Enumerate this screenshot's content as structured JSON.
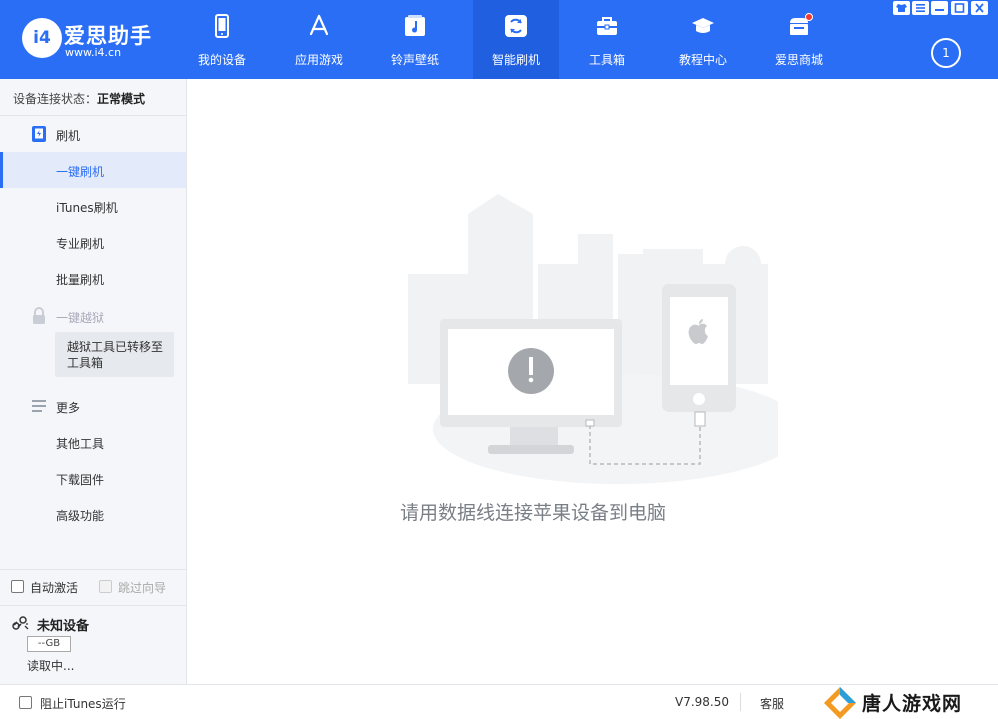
{
  "app": {
    "name": "爱思助手",
    "url": "www.i4.cn",
    "logo_text": "i4"
  },
  "nav": {
    "items": [
      {
        "label": "我的设备",
        "icon": "phone-icon"
      },
      {
        "label": "应用游戏",
        "icon": "app-store-icon"
      },
      {
        "label": "铃声壁纸",
        "icon": "music-icon"
      },
      {
        "label": "智能刷机",
        "icon": "refresh-icon",
        "active": true
      },
      {
        "label": "工具箱",
        "icon": "toolbox-icon"
      },
      {
        "label": "教程中心",
        "icon": "graduation-cap-icon"
      },
      {
        "label": "爱思商城",
        "icon": "store-icon",
        "badge": true
      }
    ],
    "downloads_count": "1"
  },
  "sidebar": {
    "connection_label": "设备连接状态：",
    "connection_value": "正常模式",
    "flash_section": "刷机",
    "flash_items": [
      "一键刷机",
      "iTunes刷机",
      "专业刷机",
      "批量刷机"
    ],
    "jailbreak_section": "一键越狱",
    "jailbreak_note": "越狱工具已转移至工具箱",
    "more_section": "更多",
    "more_items": [
      "其他工具",
      "下载固件",
      "高级功能"
    ],
    "auto_activate": "自动激活",
    "skip_guide": "跳过向导",
    "device_name": "未知设备",
    "device_storage": "--GB",
    "device_status": "读取中..."
  },
  "main": {
    "hint": "请用数据线连接苹果设备到电脑"
  },
  "statusbar": {
    "block_itunes": "阻止iTunes运行",
    "version": "V7.98.50",
    "support": "客服"
  },
  "watermark": {
    "text": "唐人游戏网"
  },
  "colors": {
    "accent": "#2b6ef6",
    "accent_dark": "#1f5fe0",
    "sidebar_bg": "#f4f6fa",
    "hint_text": "#7a7f87"
  }
}
